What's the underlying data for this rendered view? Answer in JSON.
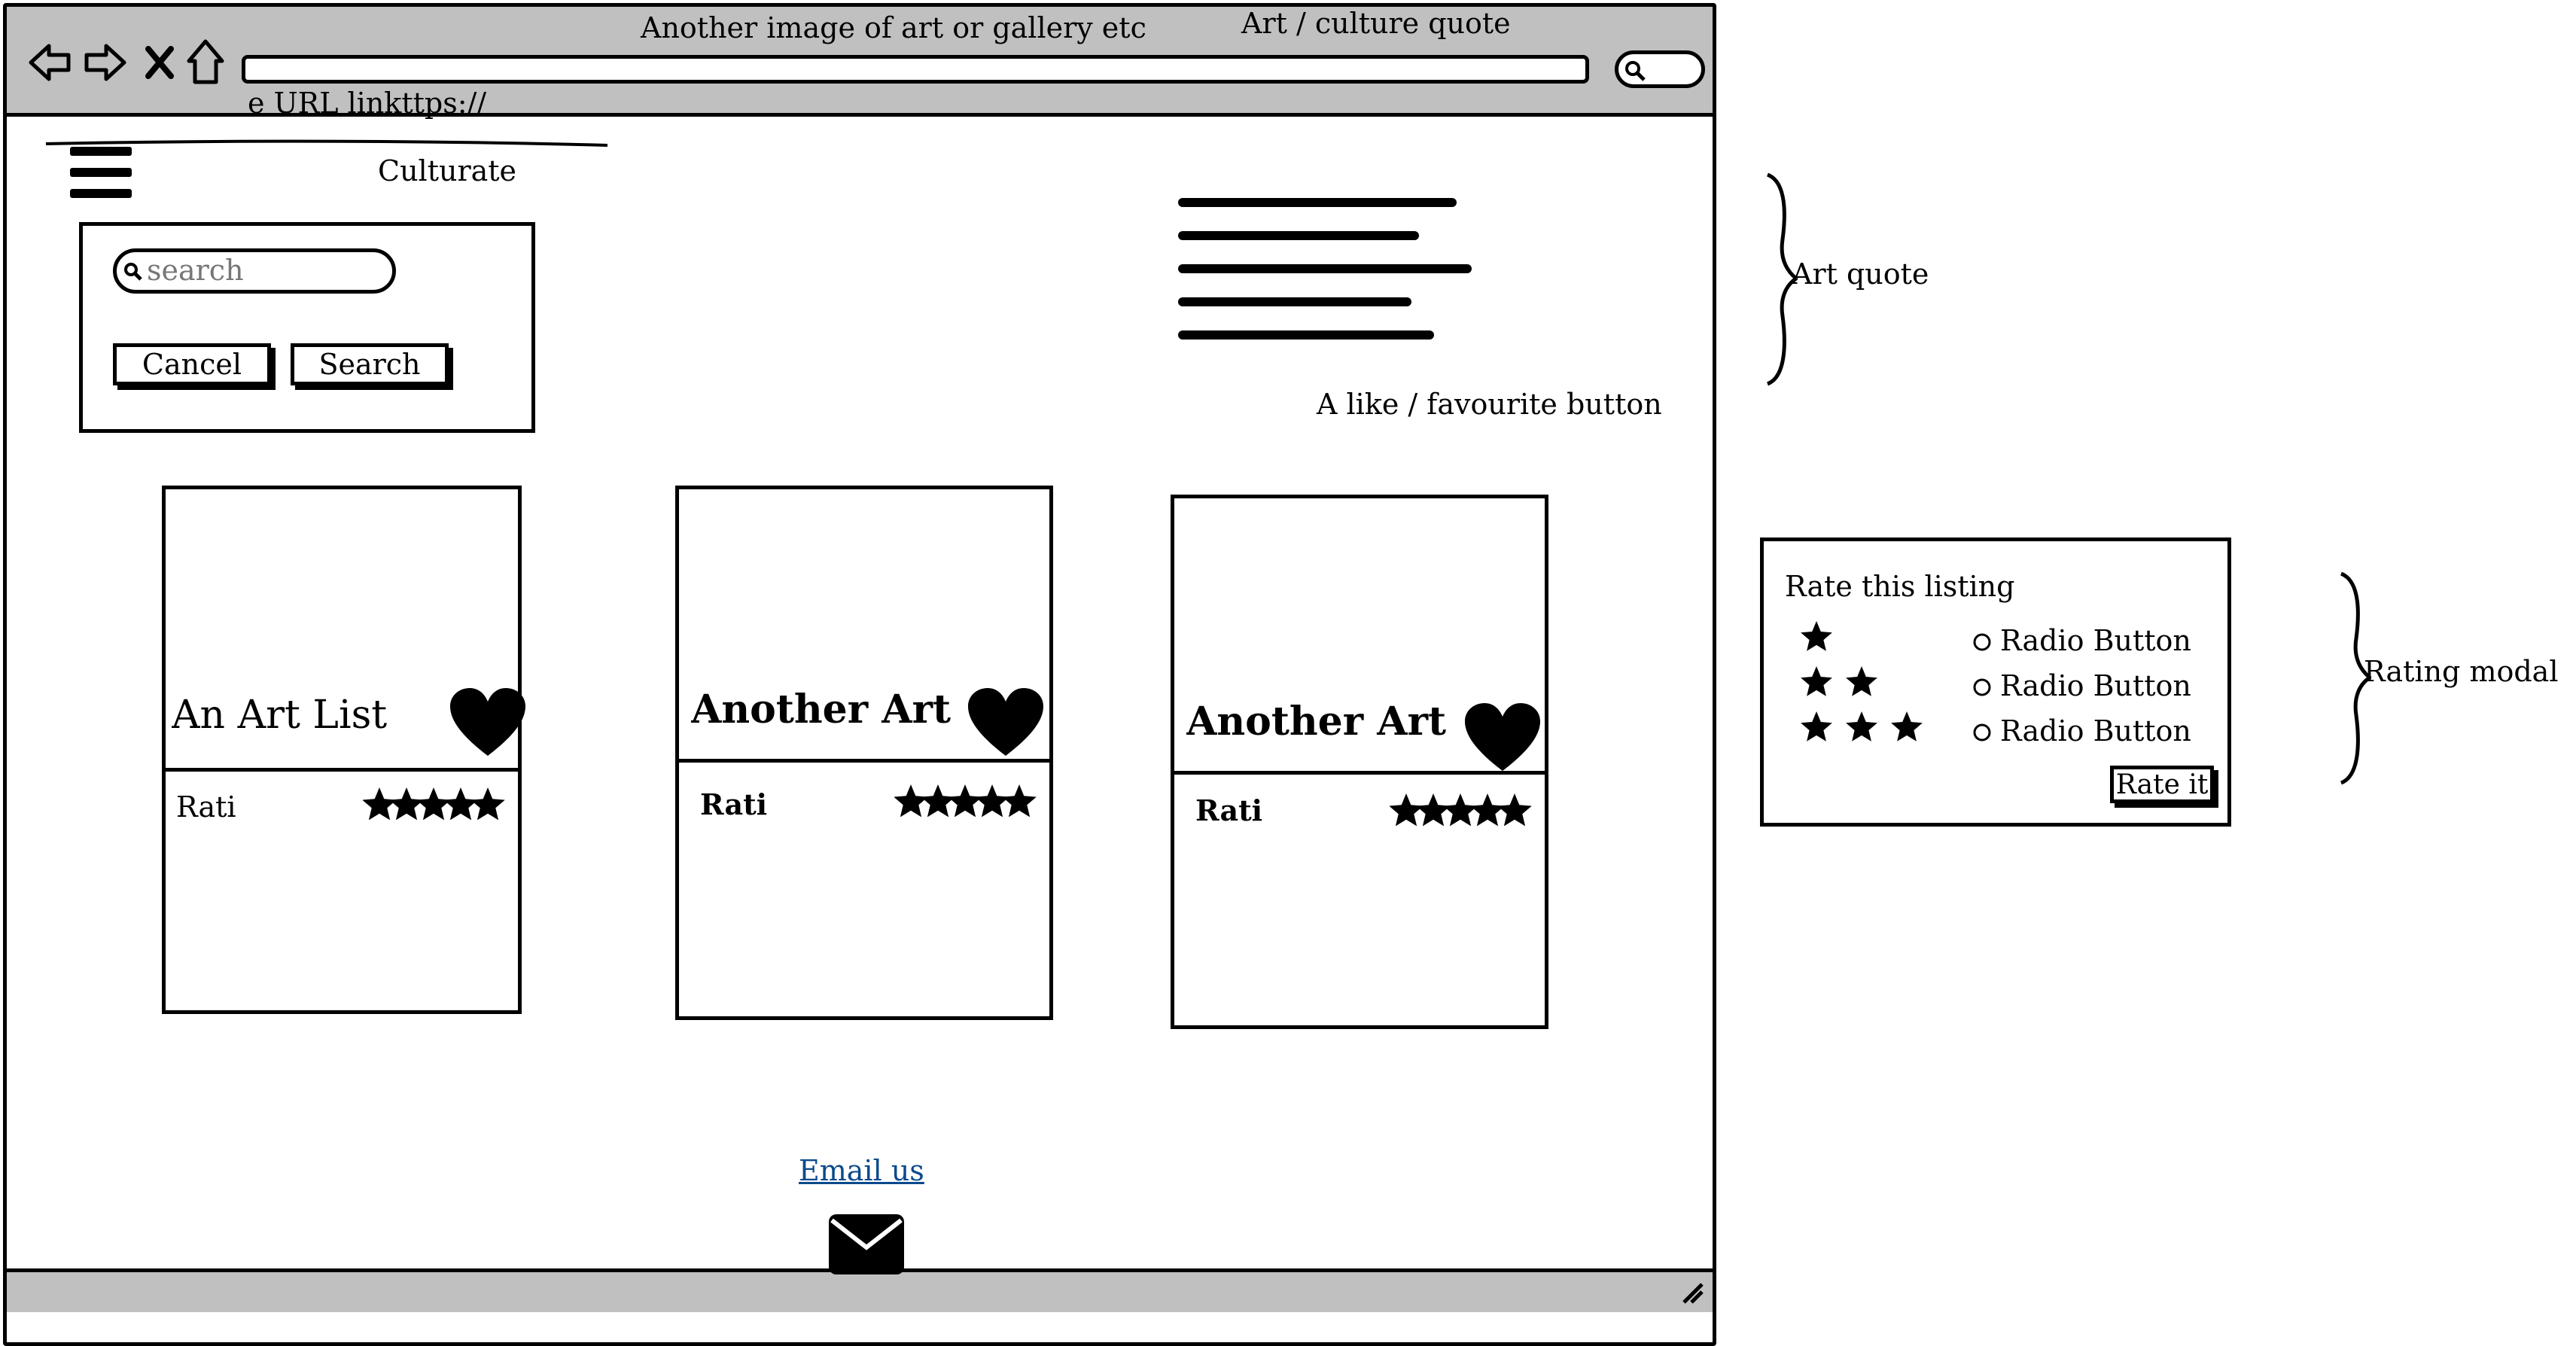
{
  "browser": {
    "titles": [
      "Another image of art or gallery etc",
      "Art / culture quote"
    ],
    "url_text": "e URL linkttps://"
  },
  "site": {
    "name": "Culturate"
  },
  "search": {
    "placeholder": "search",
    "cancel_label": "Cancel",
    "search_label": "Search"
  },
  "quote": {
    "annotation": "A like / favourite button"
  },
  "cards": [
    {
      "title": "An Art List",
      "rating_label": "Rati",
      "stars": 5
    },
    {
      "title": "Another Art Lis",
      "rating_label": "Rati",
      "stars": 5
    },
    {
      "title": "Another Art Lis",
      "rating_label": "Rati",
      "stars": 5
    }
  ],
  "footer": {
    "email_link": "Email us "
  },
  "annotations": {
    "art_quote": "Art quote",
    "rating_modal": "Rating modal"
  },
  "rating_modal": {
    "title": "Rate this listing",
    "options": [
      {
        "stars": 1,
        "label": "Radio Button"
      },
      {
        "stars": 2,
        "label": "Radio Button"
      },
      {
        "stars": 3,
        "label": "Radio Button"
      }
    ],
    "submit_label": "Rate it"
  },
  "icons": [
    "back-icon",
    "forward-icon",
    "close-icon",
    "home-icon",
    "hamburger-icon",
    "search-icon",
    "heart-icon",
    "star-icon",
    "email-icon",
    "resize-icon",
    "radio-icon"
  ]
}
